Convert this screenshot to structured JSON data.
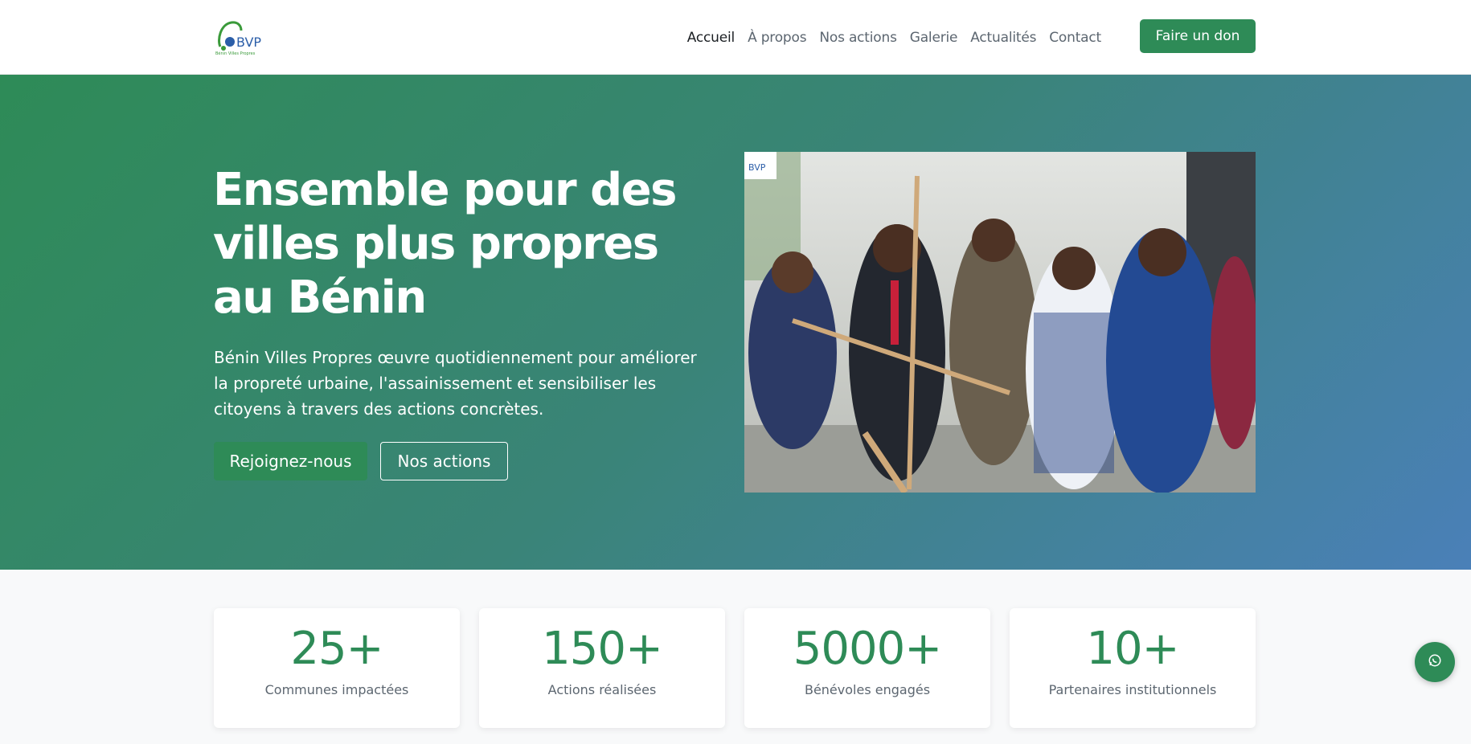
{
  "header": {
    "logo_text": "BVP",
    "logo_tagline": "Bénin Villes Propres",
    "nav": [
      {
        "label": "Accueil"
      },
      {
        "label": "À propos"
      },
      {
        "label": "Nos actions"
      },
      {
        "label": "Galerie"
      },
      {
        "label": "Actualités"
      },
      {
        "label": "Contact"
      }
    ],
    "donate_label": "Faire un don"
  },
  "hero": {
    "title": "Ensemble pour des villes plus propres au Bénin",
    "text": "Bénin Villes Propres œuvre quotidiennement pour améliorer la propreté urbaine, l'assainissement et sensibiliser les citoyens à travers des actions concrètes.",
    "join_label": "Rejoignez-nous",
    "actions_label": "Nos actions",
    "photo_badge": "BVP"
  },
  "stats": [
    {
      "value": "25+",
      "label": "Communes impactées"
    },
    {
      "value": "150+",
      "label": "Actions réalisées"
    },
    {
      "value": "5000+",
      "label": "Bénévoles engagés"
    },
    {
      "value": "10+",
      "label": "Partenaires institutionnels"
    }
  ],
  "colors": {
    "primary": "#2e8b57",
    "gradient_end": "#4a80b8"
  },
  "icons": {
    "whatsapp": "whatsapp-icon"
  }
}
